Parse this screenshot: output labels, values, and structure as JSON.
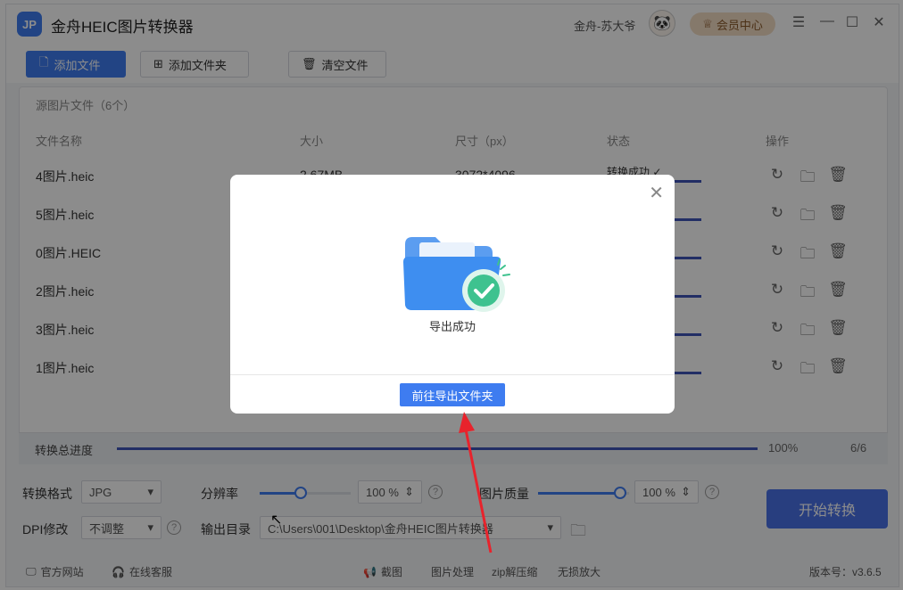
{
  "app": {
    "title": "金舟HEIC图片转换器",
    "logo_text": "JP",
    "user_name": "金舟-苏大爷",
    "vip_label": "会员中心",
    "window_controls": [
      "menu-icon",
      "minimize-icon",
      "maximize-icon",
      "close-icon"
    ]
  },
  "toolbar": {
    "add_file": "添加文件",
    "add_folder": "添加文件夹",
    "clear_files": "清空文件"
  },
  "list": {
    "source_title": "源图片文件（6个）",
    "headers": {
      "name": "文件名称",
      "size": "大小",
      "dimensions": "尺寸（px）",
      "status": "状态",
      "actions": "操作"
    },
    "rows": [
      {
        "name": "4图片.heic",
        "size": "2.67MB",
        "dimensions": "3072*4096",
        "status": "转换成功"
      },
      {
        "name": "5图片.heic"
      },
      {
        "name": "0图片.HEIC"
      },
      {
        "name": "2图片.heic"
      },
      {
        "name": "3图片.heic"
      },
      {
        "name": "1图片.heic"
      }
    ]
  },
  "progress": {
    "label": "转换总进度",
    "percent": "100%",
    "count": "6/6",
    "value": 1.0
  },
  "settings": {
    "format_label": "转换格式",
    "format_value": "JPG",
    "resolution_label": "分辨率",
    "resolution_value": "100",
    "resolution_unit": "%",
    "quality_label": "图片质量",
    "quality_value": "100",
    "quality_unit": "%",
    "dpi_label": "DPI修改",
    "dpi_value": "不调整",
    "output_label": "输出目录",
    "output_path": "C:\\Users\\001\\Desktop\\金舟HEIC图片转换器",
    "resolution_level": 0.45,
    "quality_level": 0.9
  },
  "start_button": "开始转换",
  "statusbar": {
    "website": "官方网站",
    "support": "在线客服",
    "screenshot": "截图",
    "image_process": "图片处理",
    "zip": "zip解压缩",
    "upscale": "无损放大",
    "version": "版本号：v3.6.5"
  },
  "modal": {
    "message": "导出成功",
    "open_folder_button": "前往导出文件夹"
  },
  "colors": {
    "accent": "#3e7cf0",
    "success": "#3ec28f",
    "annotation_arrow": "#e8232c"
  }
}
